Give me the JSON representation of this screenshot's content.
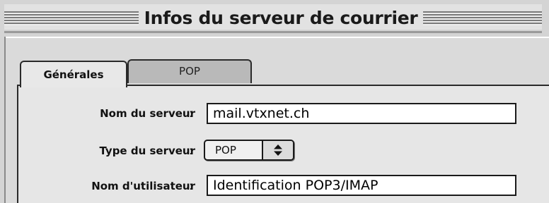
{
  "window": {
    "title": "Infos du serveur de courrier"
  },
  "tabs": [
    {
      "label": "Générales",
      "selected": true
    },
    {
      "label": "POP",
      "selected": false
    }
  ],
  "form": {
    "server_name": {
      "label": "Nom du serveur",
      "separator": ":",
      "value": "mail.vtxnet.ch"
    },
    "server_type": {
      "label": "Type du serveur",
      "separator": ":",
      "value": "POP",
      "icon": "up-down-arrows-icon"
    },
    "username": {
      "label": "Nom d'utilisateur",
      "separator": ":",
      "value": "Identification POP3/IMAP"
    }
  }
}
